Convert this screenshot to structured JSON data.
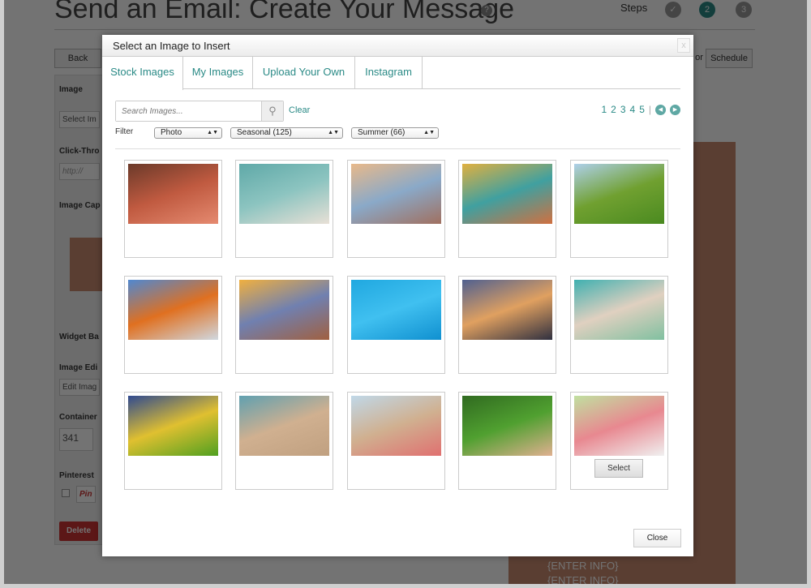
{
  "background": {
    "title": "Send an Email: Create Your Message",
    "steps_label": "Steps",
    "steps": [
      "✓",
      "2",
      "3"
    ],
    "back": "Back",
    "schedule": "Schedule",
    "or": "or",
    "panel": {
      "image": "Image",
      "select_image": "Select Im",
      "click_through": "Click-Thro",
      "url_placeholder": "http://",
      "caption": "Image Cap",
      "widget": "Widget Ba",
      "image_edit": "Image Edi",
      "edit_image": "Edit Imag",
      "container": "Container",
      "container_value": "341",
      "pinterest": "Pinterest",
      "pin": "Pin",
      "delete": "Delete"
    },
    "email_items": [
      "{ENTER INFO}",
      "{ENTER INFO}"
    ]
  },
  "modal": {
    "title": "Select an Image to Insert",
    "close_x": "x",
    "tabs": [
      {
        "label": "Stock Images",
        "active": true
      },
      {
        "label": "My Images"
      },
      {
        "label": "Upload Your Own"
      },
      {
        "label": "Instagram"
      }
    ],
    "search": {
      "placeholder": "Search Images...",
      "value": "",
      "clear": "Clear"
    },
    "pager": {
      "pages": [
        "1",
        "2",
        "3",
        "4",
        "5"
      ],
      "separator": "|"
    },
    "filter": {
      "label": "Filter",
      "type": "Photo",
      "category": "Seasonal (125)",
      "subcategory": "Summer (66)"
    },
    "images": [
      {
        "subject": "grilled burgers and hot dogs",
        "colors": [
          "#6b3a2a",
          "#c05a40",
          "#e58a70"
        ]
      },
      {
        "subject": "seashells and toy sailboat",
        "colors": [
          "#5fa9a8",
          "#8cc4c0",
          "#e8e0d6"
        ]
      },
      {
        "subject": "beach waves at sunset",
        "colors": [
          "#e8b98a",
          "#8aa9c8",
          "#a07060"
        ]
      },
      {
        "subject": "collage of summer photos",
        "colors": [
          "#e0b040",
          "#40a0a0",
          "#d07040"
        ]
      },
      {
        "subject": "pinwheel on grass",
        "colors": [
          "#aed0ea",
          "#70a030",
          "#4a8a20"
        ]
      },
      {
        "subject": "four seasons of a tree",
        "colors": [
          "#5088d0",
          "#e07020",
          "#d0d8e0"
        ]
      },
      {
        "subject": "tropical beach sunset",
        "colors": [
          "#f0b040",
          "#7080b0",
          "#a06040"
        ]
      },
      {
        "subject": "beach ball in pool",
        "colors": [
          "#20a8e0",
          "#40c0f0",
          "#1090d0"
        ]
      },
      {
        "subject": "heart hands at sunset",
        "colors": [
          "#506090",
          "#e0a060",
          "#303040"
        ]
      },
      {
        "subject": "legs by pool with drink",
        "colors": [
          "#40b0b0",
          "#e0d0c0",
          "#80c0a0"
        ]
      },
      {
        "subject": "rainbow over forest",
        "colors": [
          "#304a90",
          "#e0c030",
          "#50a020"
        ]
      },
      {
        "subject": "sandcastle and sunscreen",
        "colors": [
          "#60a0b0",
          "#d0b090",
          "#c0a080"
        ]
      },
      {
        "subject": "woman on beach towel",
        "colors": [
          "#c0d8e8",
          "#d0b090",
          "#e07070"
        ]
      },
      {
        "subject": "feet with daisies in grass",
        "colors": [
          "#306a20",
          "#50a030",
          "#e0b090"
        ]
      },
      {
        "subject": "watermelon slices",
        "colors": [
          "#c0e0a0",
          "#e88890",
          "#f0f0f0"
        ],
        "hovered": true
      }
    ],
    "select_label": "Select",
    "close_label": "Close",
    "accent": "#2a8a86"
  }
}
